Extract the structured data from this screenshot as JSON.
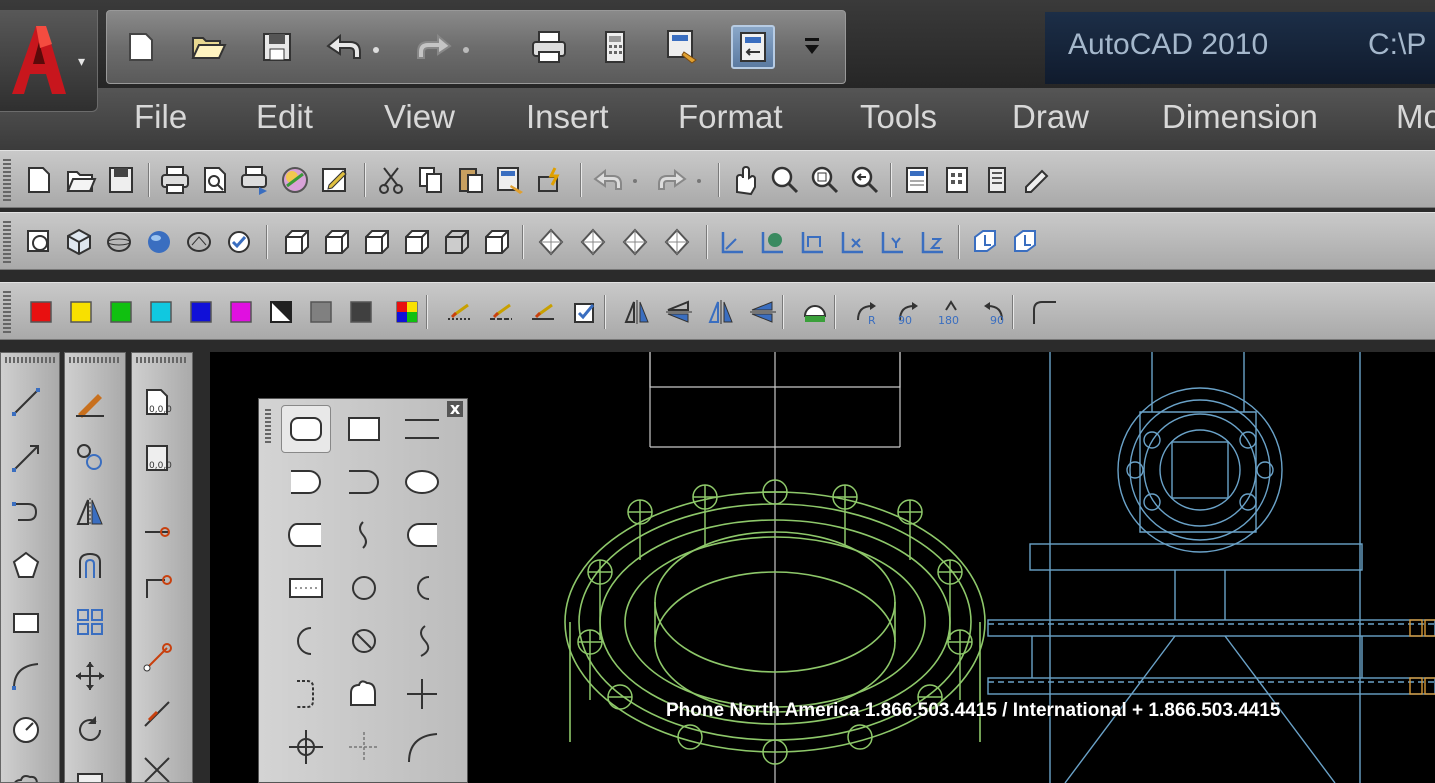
{
  "title": {
    "app_name": "AutoCAD 2010",
    "path": "C:\\P"
  },
  "menu": [
    "File",
    "Edit",
    "View",
    "Insert",
    "Format",
    "Tools",
    "Draw",
    "Dimension",
    "Mo"
  ],
  "quick_access": [
    "new-icon",
    "open-icon",
    "save-icon",
    "undo-icon",
    "redo-icon",
    "plot-icon",
    "calculator-icon",
    "match-properties-icon",
    "workspace-icon",
    "customize-icon"
  ],
  "standard_toolbar": [
    "new",
    "open",
    "save",
    "plot",
    "plot-preview",
    "publish",
    "3d-dwf",
    "sheet-set",
    "cut",
    "copy",
    "paste",
    "match-properties",
    "block-editor",
    "undo",
    "redo",
    "pan",
    "zoom-realtime",
    "zoom-window",
    "zoom-previous",
    "properties",
    "design-center",
    "tool-palettes",
    "sheet-set-manager"
  ],
  "modeling_toolbar": [
    "polysolid",
    "box",
    "sphere",
    "smooth",
    "loft",
    "check",
    "view-top",
    "view-bottom",
    "view-left",
    "view-right",
    "view-front",
    "view-back",
    "iso-sw",
    "iso-se",
    "iso-ne",
    "iso-nw",
    "ucs-3point",
    "ucs-world",
    "ucs-previous",
    "ucs-x",
    "ucs-y",
    "ucs-z",
    "ucs-face",
    "ucs-object"
  ],
  "color_swatches": {
    "red": "#e81010",
    "yellow": "#f8e000",
    "green": "#10c010",
    "cyan": "#10c8e0",
    "blue": "#1010d8",
    "magenta": "#e010e0",
    "black-white": "#202020",
    "gray": "#808080",
    "dark-gray": "#404040"
  },
  "watermark": "Phone North America 1.866.503.4415 / International + 1.866.503.4415",
  "colors": {
    "canvas": "#000000",
    "toolbar": "#bcbcbc",
    "drawing_green": "#8ec86a",
    "drawing_blue": "#6aa2c8",
    "drawing_white": "#c8c8c8",
    "drawing_orange": "#d89a3a"
  }
}
